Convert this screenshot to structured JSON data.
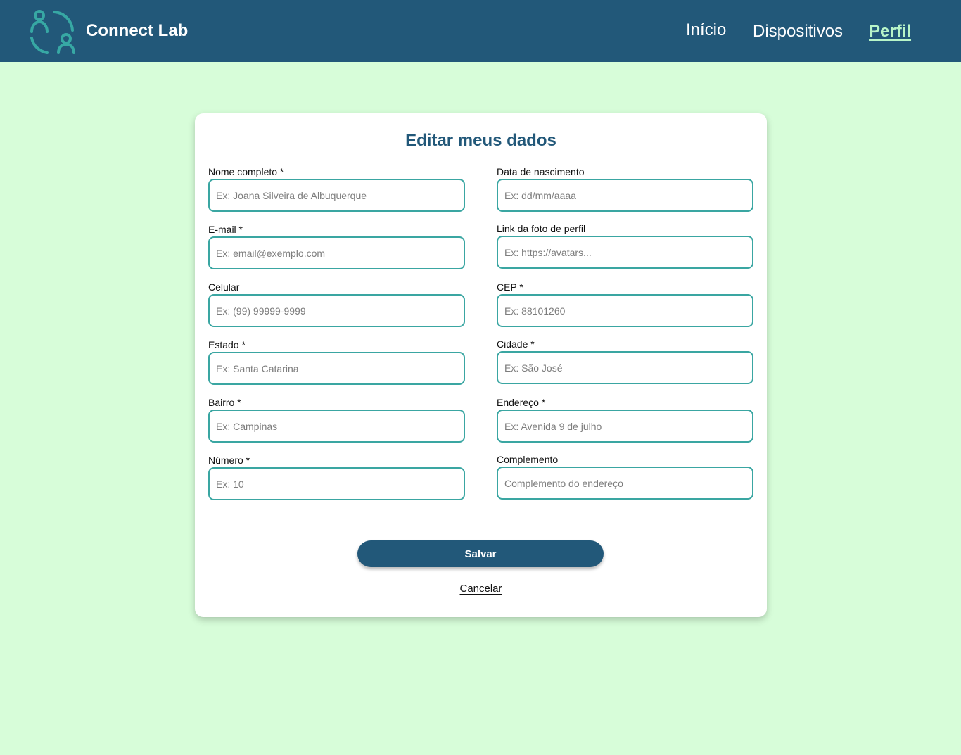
{
  "header": {
    "brand": "Connect Lab",
    "logo_icon": "people-cycle-icon",
    "nav": {
      "inicio": "Início",
      "dispositivos": "Dispositivos",
      "perfil": "Perfil"
    },
    "active_nav": "perfil"
  },
  "form": {
    "title": "Editar meus dados",
    "fields": {
      "nome": {
        "label": "Nome completo *",
        "placeholder": "Ex: Joana Silveira de Albuquerque",
        "value": ""
      },
      "nascimento": {
        "label": "Data de nascimento",
        "placeholder": "Ex: dd/mm/aaaa",
        "value": ""
      },
      "email": {
        "label": "E-mail *",
        "placeholder": "Ex: email@exemplo.com",
        "value": ""
      },
      "foto": {
        "label": "Link da foto de perfil",
        "placeholder": "Ex: https://avatars...",
        "value": ""
      },
      "celular": {
        "label": "Celular",
        "placeholder": "Ex: (99) 99999-9999",
        "value": ""
      },
      "cep": {
        "label": "CEP *",
        "placeholder": "Ex: 88101260",
        "value": ""
      },
      "estado": {
        "label": "Estado *",
        "placeholder": "Ex: Santa Catarina",
        "value": ""
      },
      "cidade": {
        "label": "Cidade *",
        "placeholder": "Ex: São José",
        "value": ""
      },
      "bairro": {
        "label": "Bairro *",
        "placeholder": "Ex: Campinas",
        "value": ""
      },
      "endereco": {
        "label": "Endereço *",
        "placeholder": "Ex: Avenida 9 de julho",
        "value": ""
      },
      "numero": {
        "label": "Número *",
        "placeholder": "Ex: 10",
        "value": ""
      },
      "complemento": {
        "label": "Complemento",
        "placeholder": "Complemento do endereço",
        "value": ""
      }
    },
    "save_label": "Salvar",
    "cancel_label": "Cancelar"
  },
  "colors": {
    "header_bg": "#225879",
    "page_bg": "#d7fdd9",
    "accent_teal": "#3aa6a2",
    "active_nav": "#b8f5c8",
    "title": "#225879"
  }
}
